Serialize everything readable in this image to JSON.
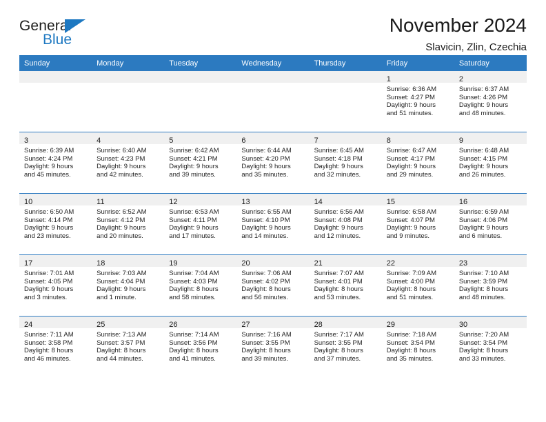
{
  "brand": {
    "word_general": "General",
    "word_blue": "Blue",
    "accent_color": "#1d78c1"
  },
  "header": {
    "title": "November 2024",
    "subtitle": "Slavicin, Zlin, Czechia"
  },
  "calendar": {
    "header_background": "#2c7ac0",
    "daynum_background": "#f0f0f0",
    "weekday_headers": [
      "Sunday",
      "Monday",
      "Tuesday",
      "Wednesday",
      "Thursday",
      "Friday",
      "Saturday"
    ],
    "weeks": [
      [
        {
          "day": "",
          "sunrise": "",
          "sunset": "",
          "daylight_line1": "",
          "daylight_line2": ""
        },
        {
          "day": "",
          "sunrise": "",
          "sunset": "",
          "daylight_line1": "",
          "daylight_line2": ""
        },
        {
          "day": "",
          "sunrise": "",
          "sunset": "",
          "daylight_line1": "",
          "daylight_line2": ""
        },
        {
          "day": "",
          "sunrise": "",
          "sunset": "",
          "daylight_line1": "",
          "daylight_line2": ""
        },
        {
          "day": "",
          "sunrise": "",
          "sunset": "",
          "daylight_line1": "",
          "daylight_line2": ""
        },
        {
          "day": "1",
          "sunrise": "Sunrise: 6:36 AM",
          "sunset": "Sunset: 4:27 PM",
          "daylight_line1": "Daylight: 9 hours",
          "daylight_line2": "and 51 minutes."
        },
        {
          "day": "2",
          "sunrise": "Sunrise: 6:37 AM",
          "sunset": "Sunset: 4:26 PM",
          "daylight_line1": "Daylight: 9 hours",
          "daylight_line2": "and 48 minutes."
        }
      ],
      [
        {
          "day": "3",
          "sunrise": "Sunrise: 6:39 AM",
          "sunset": "Sunset: 4:24 PM",
          "daylight_line1": "Daylight: 9 hours",
          "daylight_line2": "and 45 minutes."
        },
        {
          "day": "4",
          "sunrise": "Sunrise: 6:40 AM",
          "sunset": "Sunset: 4:23 PM",
          "daylight_line1": "Daylight: 9 hours",
          "daylight_line2": "and 42 minutes."
        },
        {
          "day": "5",
          "sunrise": "Sunrise: 6:42 AM",
          "sunset": "Sunset: 4:21 PM",
          "daylight_line1": "Daylight: 9 hours",
          "daylight_line2": "and 39 minutes."
        },
        {
          "day": "6",
          "sunrise": "Sunrise: 6:44 AM",
          "sunset": "Sunset: 4:20 PM",
          "daylight_line1": "Daylight: 9 hours",
          "daylight_line2": "and 35 minutes."
        },
        {
          "day": "7",
          "sunrise": "Sunrise: 6:45 AM",
          "sunset": "Sunset: 4:18 PM",
          "daylight_line1": "Daylight: 9 hours",
          "daylight_line2": "and 32 minutes."
        },
        {
          "day": "8",
          "sunrise": "Sunrise: 6:47 AM",
          "sunset": "Sunset: 4:17 PM",
          "daylight_line1": "Daylight: 9 hours",
          "daylight_line2": "and 29 minutes."
        },
        {
          "day": "9",
          "sunrise": "Sunrise: 6:48 AM",
          "sunset": "Sunset: 4:15 PM",
          "daylight_line1": "Daylight: 9 hours",
          "daylight_line2": "and 26 minutes."
        }
      ],
      [
        {
          "day": "10",
          "sunrise": "Sunrise: 6:50 AM",
          "sunset": "Sunset: 4:14 PM",
          "daylight_line1": "Daylight: 9 hours",
          "daylight_line2": "and 23 minutes."
        },
        {
          "day": "11",
          "sunrise": "Sunrise: 6:52 AM",
          "sunset": "Sunset: 4:12 PM",
          "daylight_line1": "Daylight: 9 hours",
          "daylight_line2": "and 20 minutes."
        },
        {
          "day": "12",
          "sunrise": "Sunrise: 6:53 AM",
          "sunset": "Sunset: 4:11 PM",
          "daylight_line1": "Daylight: 9 hours",
          "daylight_line2": "and 17 minutes."
        },
        {
          "day": "13",
          "sunrise": "Sunrise: 6:55 AM",
          "sunset": "Sunset: 4:10 PM",
          "daylight_line1": "Daylight: 9 hours",
          "daylight_line2": "and 14 minutes."
        },
        {
          "day": "14",
          "sunrise": "Sunrise: 6:56 AM",
          "sunset": "Sunset: 4:08 PM",
          "daylight_line1": "Daylight: 9 hours",
          "daylight_line2": "and 12 minutes."
        },
        {
          "day": "15",
          "sunrise": "Sunrise: 6:58 AM",
          "sunset": "Sunset: 4:07 PM",
          "daylight_line1": "Daylight: 9 hours",
          "daylight_line2": "and 9 minutes."
        },
        {
          "day": "16",
          "sunrise": "Sunrise: 6:59 AM",
          "sunset": "Sunset: 4:06 PM",
          "daylight_line1": "Daylight: 9 hours",
          "daylight_line2": "and 6 minutes."
        }
      ],
      [
        {
          "day": "17",
          "sunrise": "Sunrise: 7:01 AM",
          "sunset": "Sunset: 4:05 PM",
          "daylight_line1": "Daylight: 9 hours",
          "daylight_line2": "and 3 minutes."
        },
        {
          "day": "18",
          "sunrise": "Sunrise: 7:03 AM",
          "sunset": "Sunset: 4:04 PM",
          "daylight_line1": "Daylight: 9 hours",
          "daylight_line2": "and 1 minute."
        },
        {
          "day": "19",
          "sunrise": "Sunrise: 7:04 AM",
          "sunset": "Sunset: 4:03 PM",
          "daylight_line1": "Daylight: 8 hours",
          "daylight_line2": "and 58 minutes."
        },
        {
          "day": "20",
          "sunrise": "Sunrise: 7:06 AM",
          "sunset": "Sunset: 4:02 PM",
          "daylight_line1": "Daylight: 8 hours",
          "daylight_line2": "and 56 minutes."
        },
        {
          "day": "21",
          "sunrise": "Sunrise: 7:07 AM",
          "sunset": "Sunset: 4:01 PM",
          "daylight_line1": "Daylight: 8 hours",
          "daylight_line2": "and 53 minutes."
        },
        {
          "day": "22",
          "sunrise": "Sunrise: 7:09 AM",
          "sunset": "Sunset: 4:00 PM",
          "daylight_line1": "Daylight: 8 hours",
          "daylight_line2": "and 51 minutes."
        },
        {
          "day": "23",
          "sunrise": "Sunrise: 7:10 AM",
          "sunset": "Sunset: 3:59 PM",
          "daylight_line1": "Daylight: 8 hours",
          "daylight_line2": "and 48 minutes."
        }
      ],
      [
        {
          "day": "24",
          "sunrise": "Sunrise: 7:11 AM",
          "sunset": "Sunset: 3:58 PM",
          "daylight_line1": "Daylight: 8 hours",
          "daylight_line2": "and 46 minutes."
        },
        {
          "day": "25",
          "sunrise": "Sunrise: 7:13 AM",
          "sunset": "Sunset: 3:57 PM",
          "daylight_line1": "Daylight: 8 hours",
          "daylight_line2": "and 44 minutes."
        },
        {
          "day": "26",
          "sunrise": "Sunrise: 7:14 AM",
          "sunset": "Sunset: 3:56 PM",
          "daylight_line1": "Daylight: 8 hours",
          "daylight_line2": "and 41 minutes."
        },
        {
          "day": "27",
          "sunrise": "Sunrise: 7:16 AM",
          "sunset": "Sunset: 3:55 PM",
          "daylight_line1": "Daylight: 8 hours",
          "daylight_line2": "and 39 minutes."
        },
        {
          "day": "28",
          "sunrise": "Sunrise: 7:17 AM",
          "sunset": "Sunset: 3:55 PM",
          "daylight_line1": "Daylight: 8 hours",
          "daylight_line2": "and 37 minutes."
        },
        {
          "day": "29",
          "sunrise": "Sunrise: 7:18 AM",
          "sunset": "Sunset: 3:54 PM",
          "daylight_line1": "Daylight: 8 hours",
          "daylight_line2": "and 35 minutes."
        },
        {
          "day": "30",
          "sunrise": "Sunrise: 7:20 AM",
          "sunset": "Sunset: 3:54 PM",
          "daylight_line1": "Daylight: 8 hours",
          "daylight_line2": "and 33 minutes."
        }
      ]
    ]
  }
}
